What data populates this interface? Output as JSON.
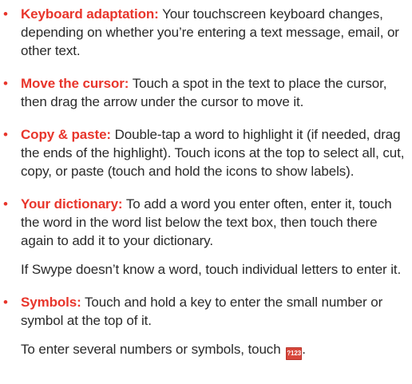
{
  "items": [
    {
      "term": "Keyboard adaptation:",
      "text": " Your touchscreen keyboard changes, depending on whether you’re entering a text message, email, or other text."
    },
    {
      "term": "Move the cursor:",
      "text": " Touch a spot in the text to place the cursor, then drag the arrow under the cursor to move it."
    },
    {
      "term": "Copy & paste:",
      "text": " Double-tap a word to highlight it (if needed, drag the ends of the highlight). Touch icons at the top to select all, cut, copy, or paste (touch and hold the icons to show labels)."
    },
    {
      "term": "Your dictionary:",
      "text": " To add a word you enter often, enter it, touch the word in the word list below the text box, then touch there again to add it to your dictionary.",
      "note": "If Swype doesn’t know a word, touch individual letters to enter it."
    },
    {
      "term": "Symbols:",
      "text": " Touch and hold a key to enter the small number or symbol at the top of it.",
      "note": "To enter several numbers or symbols, touch",
      "note_end": ".",
      "icon_label": "?123",
      "icon_name": "symbols-key-icon"
    }
  ]
}
